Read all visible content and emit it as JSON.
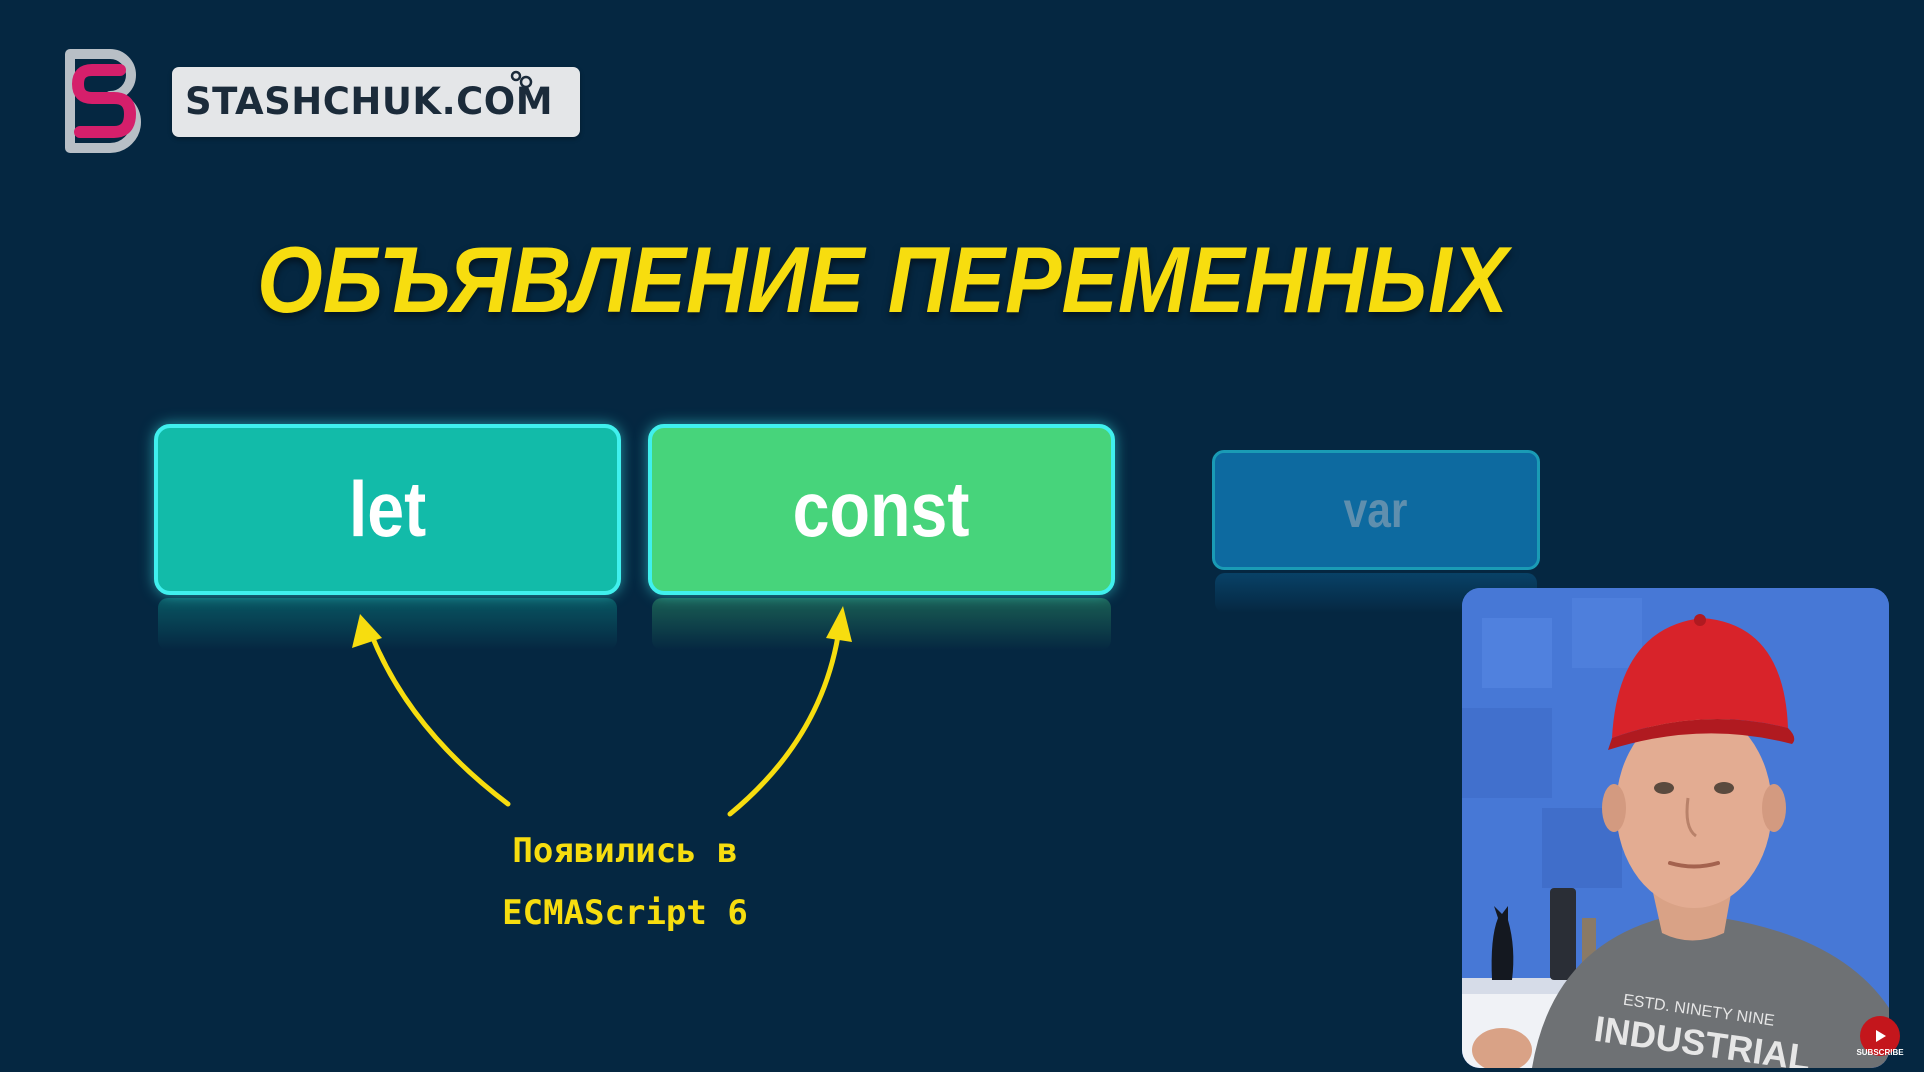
{
  "brand": {
    "site_name": "STASHCHUK.COM"
  },
  "slide": {
    "title": "ОБЪЯВЛЕНИЕ ПЕРЕМЕННЫХ",
    "keywords": [
      {
        "label": "let",
        "color": "#12bba9"
      },
      {
        "label": "const",
        "color": "#47d47b"
      },
      {
        "label": "var",
        "color": "#0d6aa0"
      }
    ],
    "annotation": {
      "line1": "Появились в",
      "line2": "ECMAScript 6"
    }
  },
  "overlay": {
    "subscribe_label": "SUBSCRIBE"
  },
  "colors": {
    "background": "#052741",
    "title": "#f7dd0f",
    "box_border": "#40f0ee",
    "arrow": "#f7dd0f"
  }
}
